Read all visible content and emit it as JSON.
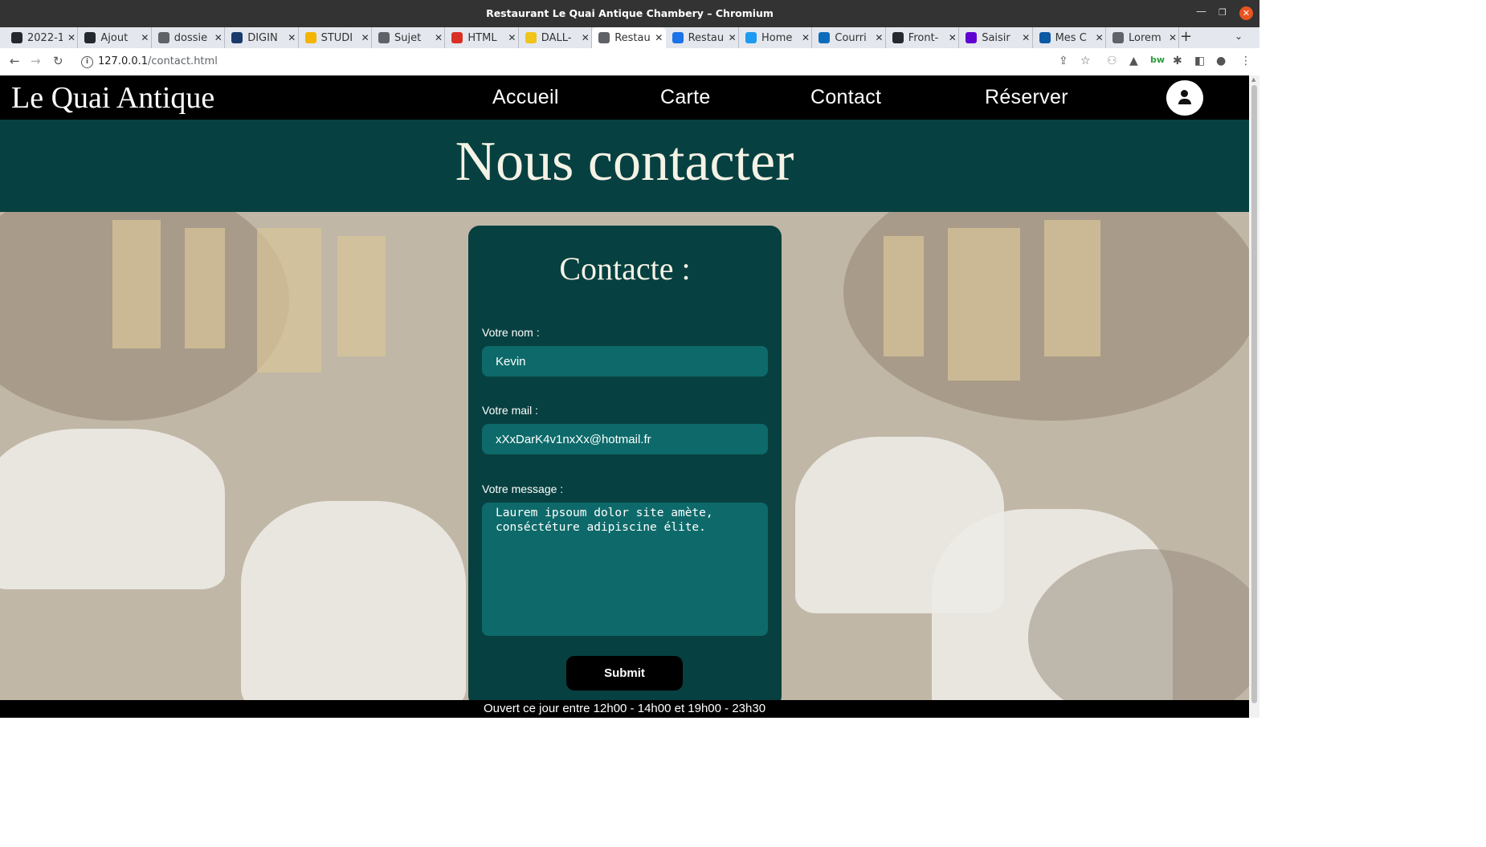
{
  "window": {
    "title": "Restaurant Le Quai Antique Chambery – Chromium"
  },
  "tabs": [
    {
      "label": "2022-1",
      "icon": "github-icon",
      "color": "#24292f"
    },
    {
      "label": "Ajout",
      "icon": "github-icon",
      "color": "#24292f"
    },
    {
      "label": "dossie",
      "icon": "globe-icon",
      "color": "#5f6368"
    },
    {
      "label": "DIGIN",
      "icon": "digin-icon",
      "color": "#1a3a6b"
    },
    {
      "label": "STUDI",
      "icon": "studi-icon",
      "color": "#f5b400"
    },
    {
      "label": "Sujet",
      "icon": "globe-icon",
      "color": "#5f6368"
    },
    {
      "label": "HTML",
      "icon": "opera-icon",
      "color": "#d93025"
    },
    {
      "label": "DALL-",
      "icon": "dalle-icon",
      "color": "#f0c419"
    },
    {
      "label": "Restau",
      "icon": "globe-icon",
      "color": "#5f6368",
      "active": true
    },
    {
      "label": "Restau",
      "icon": "page-icon",
      "color": "#1a73e8"
    },
    {
      "label": "Home",
      "icon": "twitter-icon",
      "color": "#1d9bf0"
    },
    {
      "label": "Courri",
      "icon": "outlook-icon",
      "color": "#0f6cbd"
    },
    {
      "label": "Front-",
      "icon": "github-icon",
      "color": "#24292f"
    },
    {
      "label": "Saisir",
      "icon": "yahoo-icon",
      "color": "#6001d2"
    },
    {
      "label": "Mes C",
      "icon": "edge-icon",
      "color": "#0c59a4"
    },
    {
      "label": "Lorem",
      "icon": "lorem-icon",
      "color": "#5f6368"
    }
  ],
  "address_bar": {
    "host": "127.0.0.1",
    "path": "/contact.html"
  },
  "site": {
    "logo": "Le Quai Antique",
    "nav": [
      "Accueil",
      "Carte",
      "Contact",
      "Réserver"
    ],
    "hero_title": "Nous contacter",
    "form": {
      "title": "Contacte :",
      "name_label": "Votre nom :",
      "name_value": "Kevin",
      "mail_label": "Votre mail :",
      "mail_value": "xXxDarK4v1nxXx@hotmail.fr",
      "message_label": "Votre message :",
      "message_value": "Laurem ipsoum dolor site amète, conséctéture adipiscine élite.",
      "submit_label": "Submit"
    },
    "footer": "Ouvert ce jour entre 12h00 - 14h00 et 19h00 - 23h30"
  },
  "colors": {
    "brand_dark_teal": "#074040",
    "input_teal": "#0e6a6a",
    "nav_black": "#000000"
  }
}
